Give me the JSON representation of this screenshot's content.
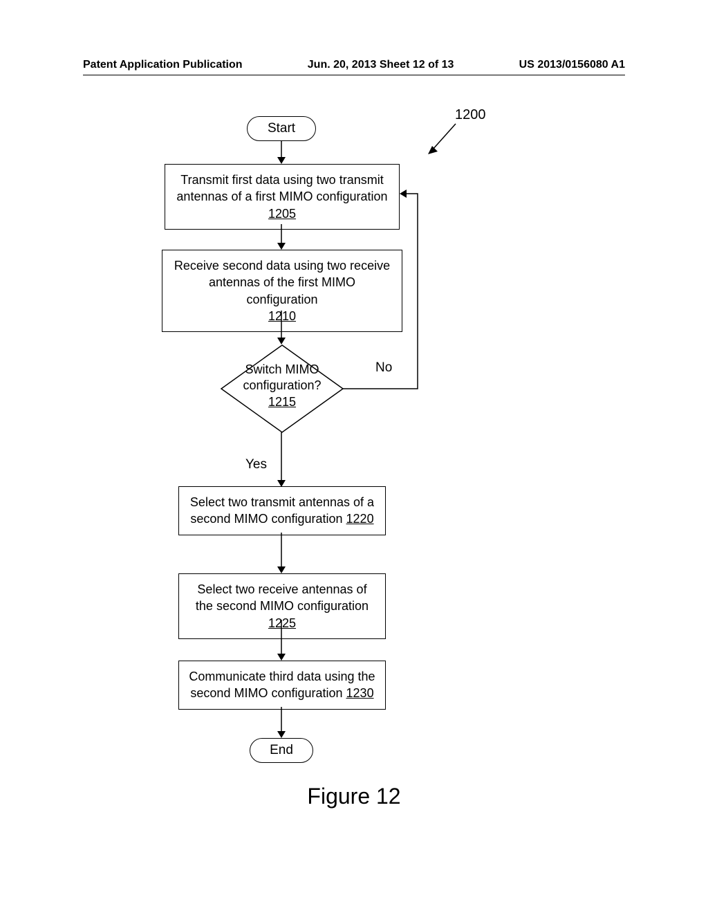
{
  "header": {
    "left": "Patent Application Publication",
    "center": "Jun. 20, 2013  Sheet 12 of 13",
    "right": "US 2013/0156080 A1"
  },
  "diagram": {
    "ref_number": "1200",
    "start": "Start",
    "end": "End",
    "box1205": {
      "text": "Transmit first data using two transmit antennas of a first MIMO configuration",
      "ref": "1205"
    },
    "box1210": {
      "text": "Receive second data using two receive antennas of the first MIMO configuration",
      "ref": "1210"
    },
    "decision1215": {
      "line1": "Switch MIMO",
      "line2": "configuration?",
      "ref": "1215"
    },
    "box1220": {
      "text": "Select two transmit antennas of a second MIMO configuration",
      "ref": "1220"
    },
    "box1225": {
      "text": "Select two receive antennas of the second MIMO configuration",
      "ref": "1225"
    },
    "box1230": {
      "text": "Communicate third data using the second MIMO configuration",
      "ref": "1230"
    },
    "yes_label": "Yes",
    "no_label": "No",
    "figure_label": "Figure 12"
  }
}
